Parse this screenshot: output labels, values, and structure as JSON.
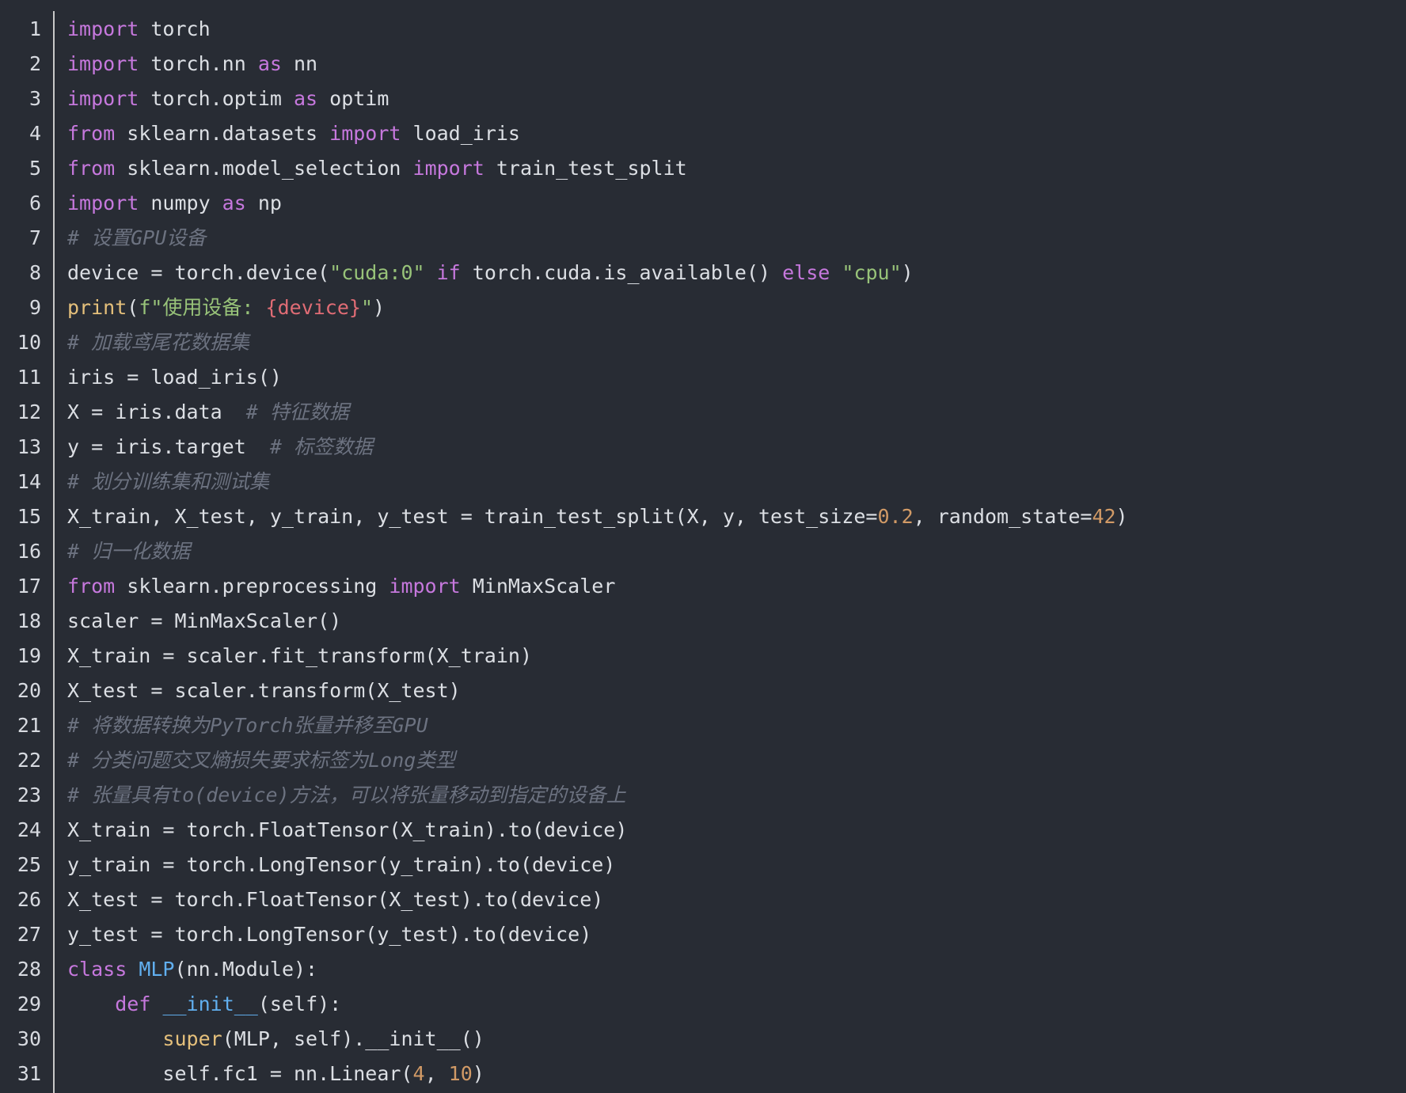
{
  "editor": {
    "language": "python",
    "colors": {
      "background": "#282c34",
      "plain": "#dcdfe4",
      "keyword": "#c678dd",
      "string": "#98c379",
      "number": "#d19a66",
      "comment": "#6c7280",
      "builtin": "#e5c07b",
      "function": "#61afef",
      "interpolation": "#e06c75",
      "line_number": "#d7dae0",
      "gutter_border": "#c8c8c8"
    },
    "lines": [
      {
        "n": "1",
        "tokens": [
          [
            "kw",
            "import"
          ],
          [
            "plain",
            " torch"
          ]
        ]
      },
      {
        "n": "2",
        "tokens": [
          [
            "kw",
            "import"
          ],
          [
            "plain",
            " torch.nn "
          ],
          [
            "kw",
            "as"
          ],
          [
            "plain",
            " nn"
          ]
        ]
      },
      {
        "n": "3",
        "tokens": [
          [
            "kw",
            "import"
          ],
          [
            "plain",
            " torch.optim "
          ],
          [
            "kw",
            "as"
          ],
          [
            "plain",
            " optim"
          ]
        ]
      },
      {
        "n": "4",
        "tokens": [
          [
            "kw",
            "from"
          ],
          [
            "plain",
            " sklearn.datasets "
          ],
          [
            "kw",
            "import"
          ],
          [
            "plain",
            " load_iris"
          ]
        ]
      },
      {
        "n": "5",
        "tokens": [
          [
            "kw",
            "from"
          ],
          [
            "plain",
            " sklearn.model_selection "
          ],
          [
            "kw",
            "import"
          ],
          [
            "plain",
            " train_test_split"
          ]
        ]
      },
      {
        "n": "6",
        "tokens": [
          [
            "kw",
            "import"
          ],
          [
            "plain",
            " numpy "
          ],
          [
            "kw",
            "as"
          ],
          [
            "plain",
            " np"
          ]
        ]
      },
      {
        "n": "7",
        "tokens": [
          [
            "cm",
            "# 设置GPU设备"
          ]
        ]
      },
      {
        "n": "8",
        "tokens": [
          [
            "plain",
            "device = torch.device("
          ],
          [
            "str",
            "\"cuda:0\""
          ],
          [
            "plain",
            " "
          ],
          [
            "kw",
            "if"
          ],
          [
            "plain",
            " torch.cuda.is_available() "
          ],
          [
            "kw",
            "else"
          ],
          [
            "plain",
            " "
          ],
          [
            "str",
            "\"cpu\""
          ],
          [
            "plain",
            ")"
          ]
        ]
      },
      {
        "n": "9",
        "tokens": [
          [
            "builtin",
            "print"
          ],
          [
            "plain",
            "("
          ],
          [
            "str",
            "f\"使用设备: "
          ],
          [
            "interp",
            "{device}"
          ],
          [
            "str",
            "\""
          ],
          [
            "plain",
            ")"
          ]
        ]
      },
      {
        "n": "10",
        "tokens": [
          [
            "cm",
            "# 加载鸢尾花数据集"
          ]
        ]
      },
      {
        "n": "11",
        "tokens": [
          [
            "plain",
            "iris = load_iris()"
          ]
        ]
      },
      {
        "n": "12",
        "tokens": [
          [
            "plain",
            "X = iris.data  "
          ],
          [
            "cm",
            "# 特征数据"
          ]
        ]
      },
      {
        "n": "13",
        "tokens": [
          [
            "plain",
            "y = iris.target  "
          ],
          [
            "cm",
            "# 标签数据"
          ]
        ]
      },
      {
        "n": "14",
        "tokens": [
          [
            "cm",
            "# 划分训练集和测试集"
          ]
        ]
      },
      {
        "n": "15",
        "tokens": [
          [
            "plain",
            "X_train, X_test, y_train, y_test = train_test_split(X, y, test_size="
          ],
          [
            "num",
            "0.2"
          ],
          [
            "plain",
            ", random_state="
          ],
          [
            "num",
            "42"
          ],
          [
            "plain",
            ")"
          ]
        ]
      },
      {
        "n": "16",
        "tokens": [
          [
            "cm",
            "# 归一化数据"
          ]
        ]
      },
      {
        "n": "17",
        "tokens": [
          [
            "kw",
            "from"
          ],
          [
            "plain",
            " sklearn.preprocessing "
          ],
          [
            "kw",
            "import"
          ],
          [
            "plain",
            " MinMaxScaler"
          ]
        ]
      },
      {
        "n": "18",
        "tokens": [
          [
            "plain",
            "scaler = MinMaxScaler()"
          ]
        ]
      },
      {
        "n": "19",
        "tokens": [
          [
            "plain",
            "X_train = scaler.fit_transform(X_train)"
          ]
        ]
      },
      {
        "n": "20",
        "tokens": [
          [
            "plain",
            "X_test = scaler.transform(X_test)"
          ]
        ]
      },
      {
        "n": "21",
        "tokens": [
          [
            "cm",
            "# 将数据转换为PyTorch张量并移至GPU"
          ]
        ]
      },
      {
        "n": "22",
        "tokens": [
          [
            "cm",
            "# 分类问题交叉熵损失要求标签为Long类型"
          ]
        ]
      },
      {
        "n": "23",
        "tokens": [
          [
            "cm",
            "# 张量具有to(device)方法，可以将张量移动到指定的设备上"
          ]
        ]
      },
      {
        "n": "24",
        "tokens": [
          [
            "plain",
            "X_train = torch.FloatTensor(X_train).to(device)"
          ]
        ]
      },
      {
        "n": "25",
        "tokens": [
          [
            "plain",
            "y_train = torch.LongTensor(y_train).to(device)"
          ]
        ]
      },
      {
        "n": "26",
        "tokens": [
          [
            "plain",
            "X_test = torch.FloatTensor(X_test).to(device)"
          ]
        ]
      },
      {
        "n": "27",
        "tokens": [
          [
            "plain",
            "y_test = torch.LongTensor(y_test).to(device)"
          ]
        ]
      },
      {
        "n": "28",
        "tokens": [
          [
            "kw",
            "class"
          ],
          [
            "plain",
            " "
          ],
          [
            "fn",
            "MLP"
          ],
          [
            "plain",
            "(nn.Module):"
          ]
        ]
      },
      {
        "n": "29",
        "tokens": [
          [
            "plain",
            "    "
          ],
          [
            "kw",
            "def"
          ],
          [
            "plain",
            " "
          ],
          [
            "fn",
            "__init__"
          ],
          [
            "plain",
            "(self):"
          ]
        ]
      },
      {
        "n": "30",
        "tokens": [
          [
            "plain",
            "        "
          ],
          [
            "builtin",
            "super"
          ],
          [
            "plain",
            "(MLP, self).__init__()"
          ]
        ]
      },
      {
        "n": "31",
        "tokens": [
          [
            "plain",
            "        self.fc1 = nn.Linear("
          ],
          [
            "num",
            "4"
          ],
          [
            "plain",
            ", "
          ],
          [
            "num",
            "10"
          ],
          [
            "plain",
            ")"
          ]
        ]
      }
    ]
  }
}
